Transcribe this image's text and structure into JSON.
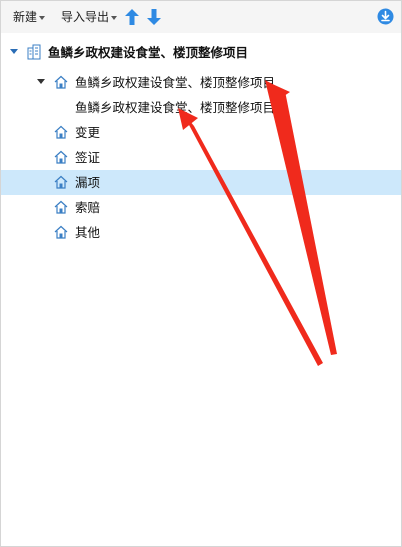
{
  "toolbar": {
    "new_label": "新建",
    "import_export_label": "导入导出",
    "move_up_icon": "arrow-up-icon",
    "move_down_icon": "arrow-down-icon",
    "download_icon": "download-circle-icon"
  },
  "tree": {
    "root": {
      "label": "鱼鳞乡政权建设食堂、楼顶整修项目",
      "icon": "building-icon",
      "expanded": true
    },
    "project": {
      "label": "鱼鳞乡政权建设食堂、楼顶整修项目",
      "icon": "house-icon",
      "expanded": true
    },
    "project_child": {
      "label": "鱼鳞乡政权建设食堂、楼顶整修项目"
    },
    "items": [
      {
        "label": "变更",
        "icon": "house-icon",
        "selected": false
      },
      {
        "label": "签证",
        "icon": "house-icon",
        "selected": false
      },
      {
        "label": "漏项",
        "icon": "house-icon",
        "selected": true
      },
      {
        "label": "索赔",
        "icon": "house-icon",
        "selected": false
      },
      {
        "label": "其他",
        "icon": "house-icon",
        "selected": false
      }
    ]
  },
  "colors": {
    "selected_row": "#cde8fb",
    "accent_blue": "#2f8ae3",
    "annotation_red": "#f02a1c"
  }
}
